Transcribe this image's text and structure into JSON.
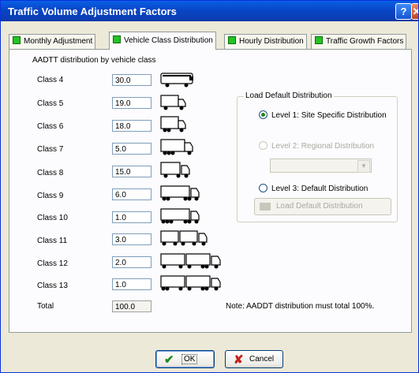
{
  "window": {
    "title": "Traffic Volume Adjustment Factors"
  },
  "title_buttons": {
    "help": "?"
  },
  "tabs": [
    {
      "label": "Monthly Adjustment"
    },
    {
      "label": "Vehicle Class Distribution"
    },
    {
      "label": "Hourly Distribution"
    },
    {
      "label": "Traffic Growth Factors"
    }
  ],
  "section_label": "AADTT distribution by vehicle class",
  "classes": [
    {
      "label": "Class 4",
      "value": "30.0"
    },
    {
      "label": "Class 5",
      "value": "19.0"
    },
    {
      "label": "Class 6",
      "value": "18.0"
    },
    {
      "label": "Class 7",
      "value": "5.0"
    },
    {
      "label": "Class 8",
      "value": "15.0"
    },
    {
      "label": "Class 9",
      "value": "6.0"
    },
    {
      "label": "Class 10",
      "value": "1.0"
    },
    {
      "label": "Class 11",
      "value": "3.0"
    },
    {
      "label": "Class 12",
      "value": "2.0"
    },
    {
      "label": "Class 13",
      "value": "1.0"
    }
  ],
  "total": {
    "label": "Total",
    "value": "100.0"
  },
  "load_default": {
    "group_title": "Load Default Distribution",
    "level1": "Level 1: Site Specific Distribution",
    "level2": "Level 2: Regional Distribution",
    "level3": "Level 3: Default Distribution",
    "load_button": "Load Default Distribution",
    "selected": "level1"
  },
  "note": "Note: AADDT distribution must total 100%.",
  "buttons": {
    "ok": "OK",
    "cancel": "Cancel"
  },
  "colors": {
    "titlebar": "#0846c5",
    "tab_check": "#22c422",
    "ok_check": "#1f8a1f",
    "cancel_x": "#c4231d"
  }
}
